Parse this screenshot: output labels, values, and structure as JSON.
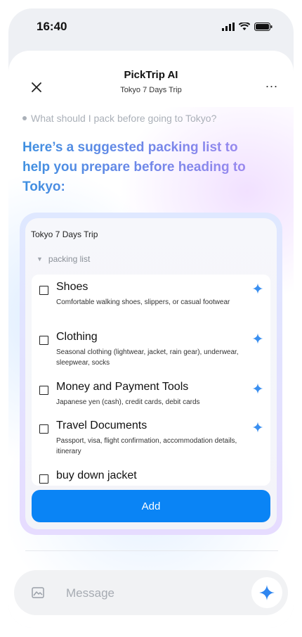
{
  "status": {
    "time": "16:40"
  },
  "header": {
    "title": "PickTrip AI",
    "subtitle": "Tokyo 7 Days Trip",
    "more": "..."
  },
  "chat": {
    "question": "What should I pack before going to Tokyo?",
    "answer": "Here’s a suggested packing list to help you prepare before heading to Tokyo:"
  },
  "card": {
    "title": "Tokyo 7 Days Trip",
    "section": "packing list",
    "items": [
      {
        "title": "Shoes",
        "desc": "Comfortable walking shoes, slippers, or casual footwear"
      },
      {
        "title": "Clothing",
        "desc": "Seasonal clothing (lightwear, jacket, rain gear), underwear, sleepwear, socks"
      },
      {
        "title": "Money and Payment Tools",
        "desc": "Japanese yen (cash), credit cards, debit cards"
      },
      {
        "title": "Travel Documents",
        "desc": "Passport, visa, flight confirmation, accommodation details, itinerary"
      },
      {
        "title": "buy down jacket",
        "desc": ""
      }
    ],
    "add_label": "Add"
  },
  "composer": {
    "placeholder": "Message"
  },
  "colors": {
    "accent": "#0a84f5",
    "sparkle": "#3a8ff0"
  },
  "icons": [
    "close-icon",
    "more-icon",
    "sparkle-icon",
    "image-icon",
    "signal-icon",
    "wifi-icon",
    "battery-icon"
  ]
}
